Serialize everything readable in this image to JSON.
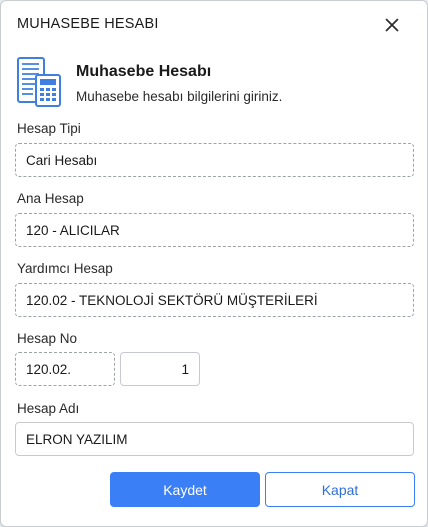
{
  "window": {
    "title": "MUHASEBE HESABI"
  },
  "header": {
    "title": "Muhasebe Hesabı",
    "subtitle": "Muhasebe hesabı bilgilerini giriniz."
  },
  "form": {
    "hesap_tipi": {
      "label": "Hesap Tipi",
      "value": "Cari Hesabı"
    },
    "ana_hesap": {
      "label": "Ana Hesap",
      "value": "120 -  ALICILAR"
    },
    "yardimci_hesap": {
      "label": "Yardımcı Hesap",
      "value": "120.02 - TEKNOLOJİ SEKTÖRÜ MÜŞTERİLERİ"
    },
    "hesap_no": {
      "label": "Hesap No",
      "prefix": "120.02.",
      "number": "1"
    },
    "hesap_adi": {
      "label": "Hesap Adı",
      "value": "ELRON YAZILIM"
    }
  },
  "buttons": {
    "save": "Kaydet",
    "close": "Kapat"
  },
  "colors": {
    "primary": "#3a7ff5",
    "icon": "#3f7fe0"
  }
}
